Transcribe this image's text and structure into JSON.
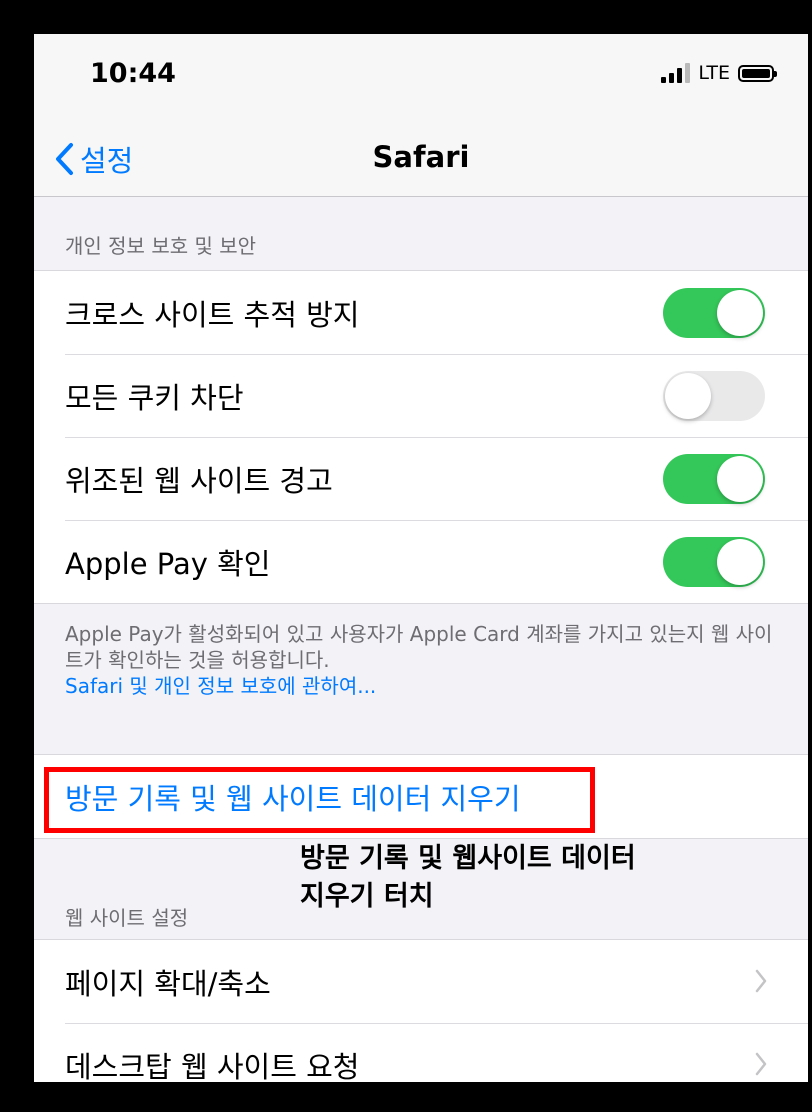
{
  "status_bar": {
    "time": "10:44",
    "network": "LTE"
  },
  "nav": {
    "back_label": "설정",
    "title": "Safari"
  },
  "privacy_section": {
    "header": "개인 정보 보호 및 보안",
    "rows": [
      {
        "label": "크로스 사이트 추적 방지",
        "toggle": "on"
      },
      {
        "label": "모든 쿠키 차단",
        "toggle": "off"
      },
      {
        "label": "위조된 웹 사이트 경고",
        "toggle": "on"
      },
      {
        "label": "Apple Pay 확인",
        "toggle": "on"
      }
    ],
    "footer_text": "Apple Pay가 활성화되어 있고 사용자가 Apple Card 계좌를 가지고 있는지 웹 사이트가 확인하는 것을 허용합니다.",
    "footer_link": "Safari 및 개인 정보 보호에 관하여..."
  },
  "clear_history": {
    "label": "방문 기록 및 웹 사이트 데이터 지우기"
  },
  "annotation": {
    "line1": "방문 기록 및 웹사이트 데이터",
    "line2": "지우기 터치"
  },
  "website_section": {
    "header": "웹 사이트 설정",
    "rows": [
      {
        "label": "페이지 확대/축소"
      },
      {
        "label": "데스크탑 웹 사이트 요청"
      }
    ]
  },
  "colors": {
    "accent": "#007aff",
    "toggle_on": "#34c759",
    "highlight": "#ff0000"
  }
}
